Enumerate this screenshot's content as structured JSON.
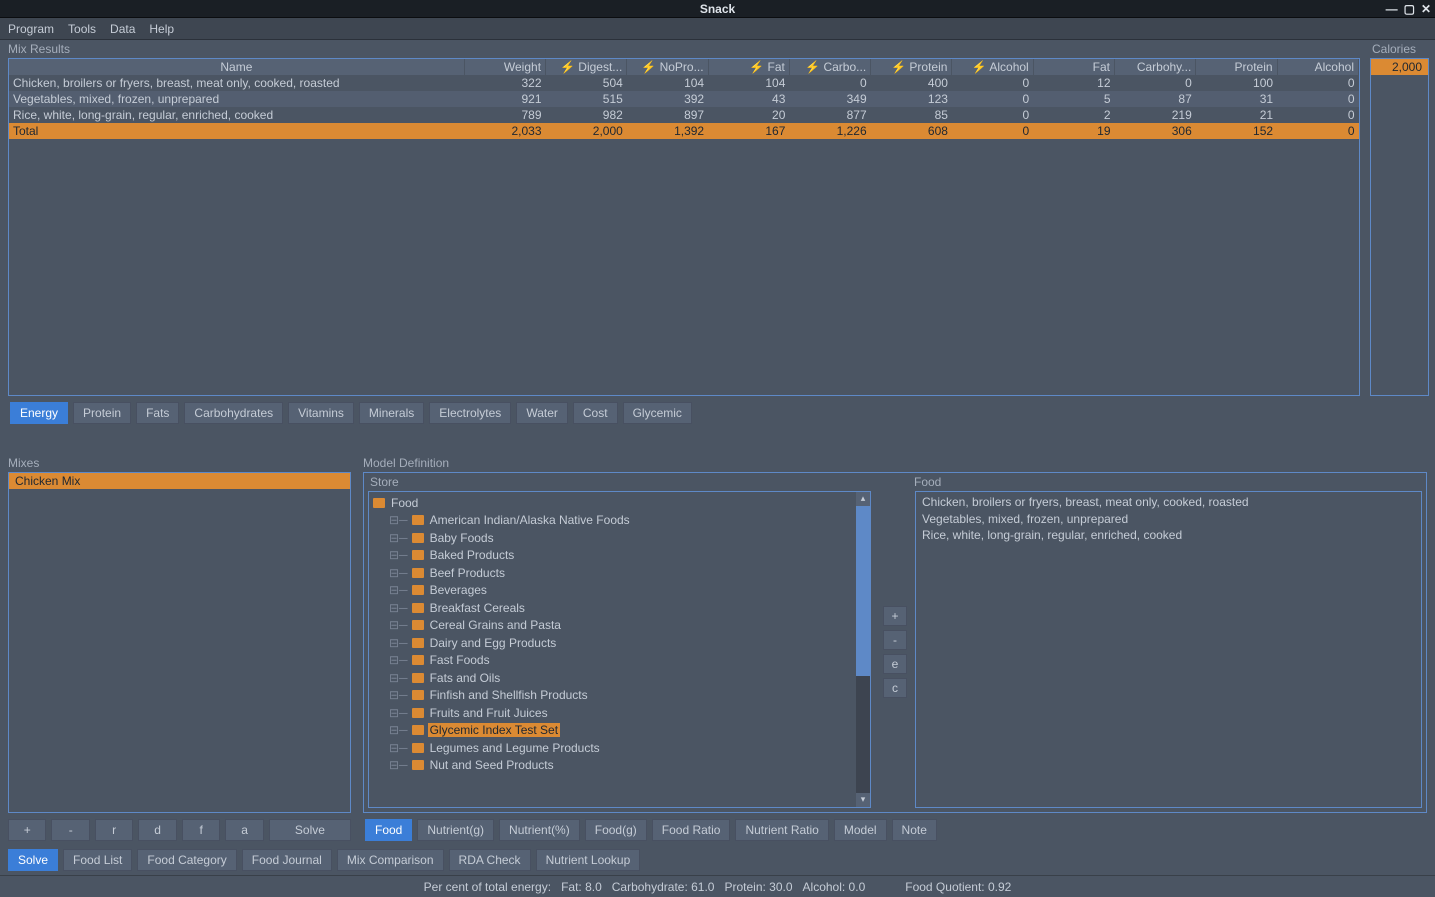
{
  "window": {
    "title": "Snack"
  },
  "menu": {
    "program": "Program",
    "tools": "Tools",
    "data": "Data",
    "help": "Help"
  },
  "mix_results": {
    "title": "Mix Results",
    "calories_label": "Calories",
    "calories_value": "2,000",
    "columns": [
      "Name",
      "Weight",
      "⚡ Digest...",
      "⚡ NoPro...",
      "⚡ Fat",
      "⚡ Carbo...",
      "⚡ Protein",
      "⚡ Alcohol",
      "Fat",
      "Carbohy...",
      "Protein",
      "Alcohol"
    ],
    "rows": [
      {
        "cells": [
          "Chicken, broilers or fryers, breast, meat only, cooked, roasted",
          "322",
          "504",
          "104",
          "104",
          "0",
          "400",
          "0",
          "12",
          "0",
          "100",
          "0"
        ]
      },
      {
        "cells": [
          "Vegetables, mixed, frozen, unprepared",
          "921",
          "515",
          "392",
          "43",
          "349",
          "123",
          "0",
          "5",
          "87",
          "31",
          "0"
        ]
      },
      {
        "cells": [
          "Rice, white, long-grain, regular, enriched, cooked",
          "789",
          "982",
          "897",
          "20",
          "877",
          "85",
          "0",
          "2",
          "219",
          "21",
          "0"
        ]
      }
    ],
    "total": [
      "Total",
      "2,033",
      "2,000",
      "1,392",
      "167",
      "1,226",
      "608",
      "0",
      "19",
      "306",
      "152",
      "0"
    ]
  },
  "energy_tabs": [
    "Energy",
    "Protein",
    "Fats",
    "Carbohydrates",
    "Vitamins",
    "Minerals",
    "Electrolytes",
    "Water",
    "Cost",
    "Glycemic"
  ],
  "mixes": {
    "title": "Mixes",
    "items": [
      "Chicken Mix"
    ],
    "btns": [
      "+",
      "-",
      "r",
      "d",
      "f",
      "a",
      "Solve"
    ]
  },
  "model": {
    "title": "Model Definition",
    "store_label": "Store",
    "food_label": "Food",
    "tree": [
      {
        "label": "Food",
        "root": true
      },
      {
        "label": "American Indian/Alaska Native Foods"
      },
      {
        "label": "Baby Foods"
      },
      {
        "label": "Baked Products"
      },
      {
        "label": "Beef Products"
      },
      {
        "label": "Beverages"
      },
      {
        "label": "Breakfast Cereals"
      },
      {
        "label": "Cereal Grains and Pasta"
      },
      {
        "label": "Dairy and Egg Products"
      },
      {
        "label": "Fast Foods"
      },
      {
        "label": "Fats and Oils"
      },
      {
        "label": "Finfish and Shellfish Products"
      },
      {
        "label": "Fruits and Fruit Juices"
      },
      {
        "label": "Glycemic Index Test Set",
        "selected": true
      },
      {
        "label": "Legumes and Legume Products"
      },
      {
        "label": "Nut and Seed Products"
      }
    ],
    "tree_btns": [
      "+",
      "-",
      "e",
      "c"
    ],
    "food_items": [
      "Chicken, broilers or fryers, breast, meat only, cooked, roasted",
      "Vegetables, mixed, frozen, unprepared",
      "Rice, white, long-grain, regular, enriched, cooked"
    ],
    "food_tabs": [
      "Food",
      "Nutrient(g)",
      "Nutrient(%)",
      "Food(g)",
      "Food Ratio",
      "Nutrient Ratio",
      "Model",
      "Note"
    ]
  },
  "bottom_tabs": [
    "Solve",
    "Food List",
    "Food Category",
    "Food Journal",
    "Mix Comparison",
    "RDA Check",
    "Nutrient Lookup"
  ],
  "status": {
    "label": "Per cent of total energy:",
    "fat": "Fat: 8.0",
    "carb": "Carbohydrate: 61.0",
    "protein": "Protein: 30.0",
    "alcohol": "Alcohol: 0.0",
    "fq": "Food Quotient: 0.92"
  }
}
